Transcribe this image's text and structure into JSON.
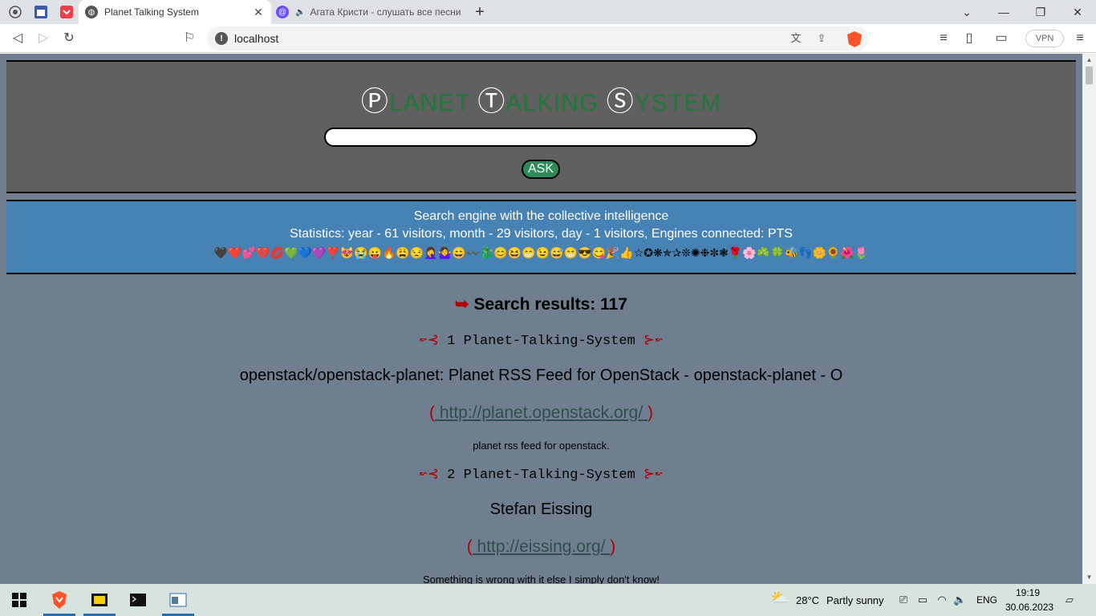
{
  "browser": {
    "tabs": [
      {
        "title": "Planet Talking System",
        "active": true
      },
      {
        "title": "Агата Кристи - слушать все песни",
        "active": false
      }
    ],
    "new_tab": "+",
    "window_controls": {
      "minimize": "—",
      "maximize": "❐",
      "close": "✕",
      "tablist": "⌄"
    },
    "address": "localhost",
    "vpn_label": "VPN"
  },
  "page": {
    "logo": {
      "p": "Ⓟ",
      "p_rest": "LANET ",
      "t": "Ⓣ",
      "t_rest": "ALKING ",
      "s": "Ⓢ",
      "s_rest": "YSTEM"
    },
    "search_placeholder": "",
    "ask_label": "ASK",
    "tagline": "Search engine with the collective intelligence",
    "statistics": "Statistics: year - 61 visitors, month - 29 visitors, day - 1 visitors, Engines connected: PTS",
    "emoji_row": "🖤❤️💕💔💋💚💙💜❣️😻😭😛🔥😩😒🤦‍♀️🤷‍♀️😄〰️🐉😊😆😁😉😅😁😎😋🎉👍☆✪❋✯✰❊✺❉✼❃🌹🌸☘️🍀🐝👣🌼🌻🌺🌷",
    "results_arrow": "➥",
    "results_label": "Search results: 117",
    "results": [
      {
        "number_label": "1 Planet-Talking-System",
        "orn_left": "↜⊰",
        "orn_right": "⊱↜",
        "title": "openstack/openstack-planet: Planet RSS Feed for OpenStack - openstack-planet - O",
        "paren_open": "(",
        "url": " http://planet.openstack.org/ ",
        "paren_close": ")",
        "description": "planet rss feed for openstack."
      },
      {
        "number_label": "2 Planet-Talking-System",
        "orn_left": "↜⊰",
        "orn_right": "⊱↜",
        "title": "Stefan Eissing",
        "paren_open": "(",
        "url": " http://eissing.org/ ",
        "paren_close": ")",
        "description": "Something is wrong with it else I simply don't know!"
      }
    ]
  },
  "taskbar": {
    "weather_temp": "28°C",
    "weather_text": "Partly sunny",
    "language": "ENG",
    "time": "19:19",
    "date": "30.06.2023"
  }
}
